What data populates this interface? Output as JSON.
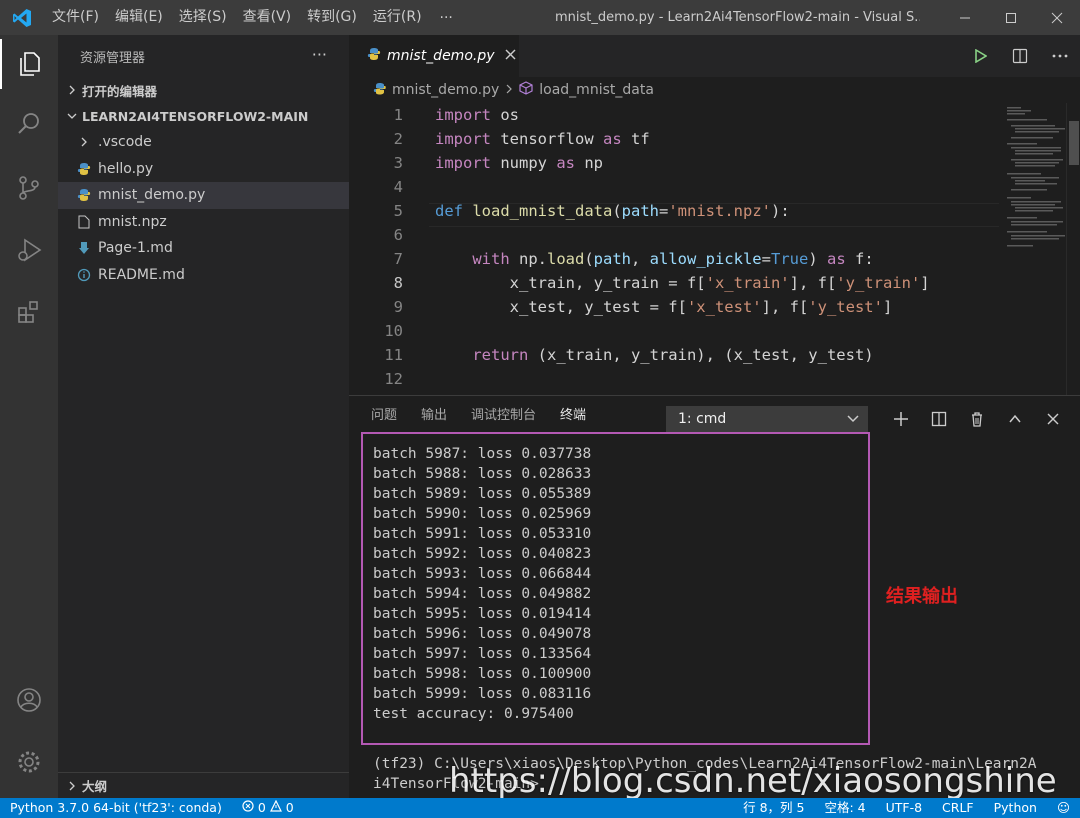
{
  "app": {
    "window_title": "mnist_demo.py - Learn2Ai4TensorFlow2-main - Visual S...",
    "menu": [
      "文件(F)",
      "编辑(E)",
      "选择(S)",
      "查看(V)",
      "转到(G)",
      "运行(R)"
    ],
    "menu_more": "···"
  },
  "sidebar": {
    "title": "资源管理器",
    "more": "···",
    "open_editors": "打开的编辑器",
    "project": "LEARN2AI4TENSORFLOW2-MAIN",
    "items": [
      {
        "label": ".vscode",
        "icon": "chevron-right-icon"
      },
      {
        "label": "hello.py",
        "icon": "python-icon"
      },
      {
        "label": "mnist_demo.py",
        "icon": "python-icon"
      },
      {
        "label": "mnist.npz",
        "icon": "file-icon"
      },
      {
        "label": "Page-1.md",
        "icon": "markdown-icon"
      },
      {
        "label": "README.md",
        "icon": "info-icon"
      }
    ],
    "outline": "大纲"
  },
  "editor": {
    "tab_label": "mnist_demo.py",
    "breadcrumb_file": "mnist_demo.py",
    "breadcrumb_symbol": "load_mnist_data",
    "current_line": 8,
    "lines": [
      "import os",
      "import tensorflow as tf",
      "import numpy as np",
      "",
      "def load_mnist_data(path='mnist.npz'):",
      "",
      "    with np.load(path, allow_pickle=True) as f:",
      "        x_train, y_train = f['x_train'], f['y_train']",
      "        x_test, y_test = f['x_test'], f['y_test']",
      "",
      "    return (x_train, y_train), (x_test, y_test)",
      ""
    ]
  },
  "panel": {
    "tabs": [
      "问题",
      "输出",
      "调试控制台",
      "终端"
    ],
    "active_tab": "终端",
    "terminal_select": "1: cmd",
    "output": [
      "batch 5987: loss 0.037738",
      "batch 5988: loss 0.028633",
      "batch 5989: loss 0.055389",
      "batch 5990: loss 0.025969",
      "batch 5991: loss 0.053310",
      "batch 5992: loss 0.040823",
      "batch 5993: loss 0.066844",
      "batch 5994: loss 0.049882",
      "batch 5995: loss 0.019414",
      "batch 5996: loss 0.049078",
      "batch 5997: loss 0.133564",
      "batch 5998: loss 0.100900",
      "batch 5999: loss 0.083116",
      "test accuracy: 0.975400"
    ],
    "annotation": "结果输出",
    "prompt_line1": "(tf23) C:\\Users\\xiaos\\Desktop\\Python_codes\\Learn2Ai4TensorFlow2-main\\Learn2A",
    "prompt_line2": "i4TensorFlow2-main>",
    "watermark": "https://blog.csdn.net/xiaosongshine"
  },
  "statusbar": {
    "interpreter": "Python 3.7.0 64-bit ('tf23': conda)",
    "errors": "0",
    "warnings": "0",
    "position": "行 8，列 5",
    "spaces": "空格: 4",
    "encoding": "UTF-8",
    "eol": "CRLF",
    "language": "Python"
  },
  "colors": {
    "accent": "#007acc",
    "annotation_box": "#b459b4",
    "annotation_text": "#e02020"
  }
}
